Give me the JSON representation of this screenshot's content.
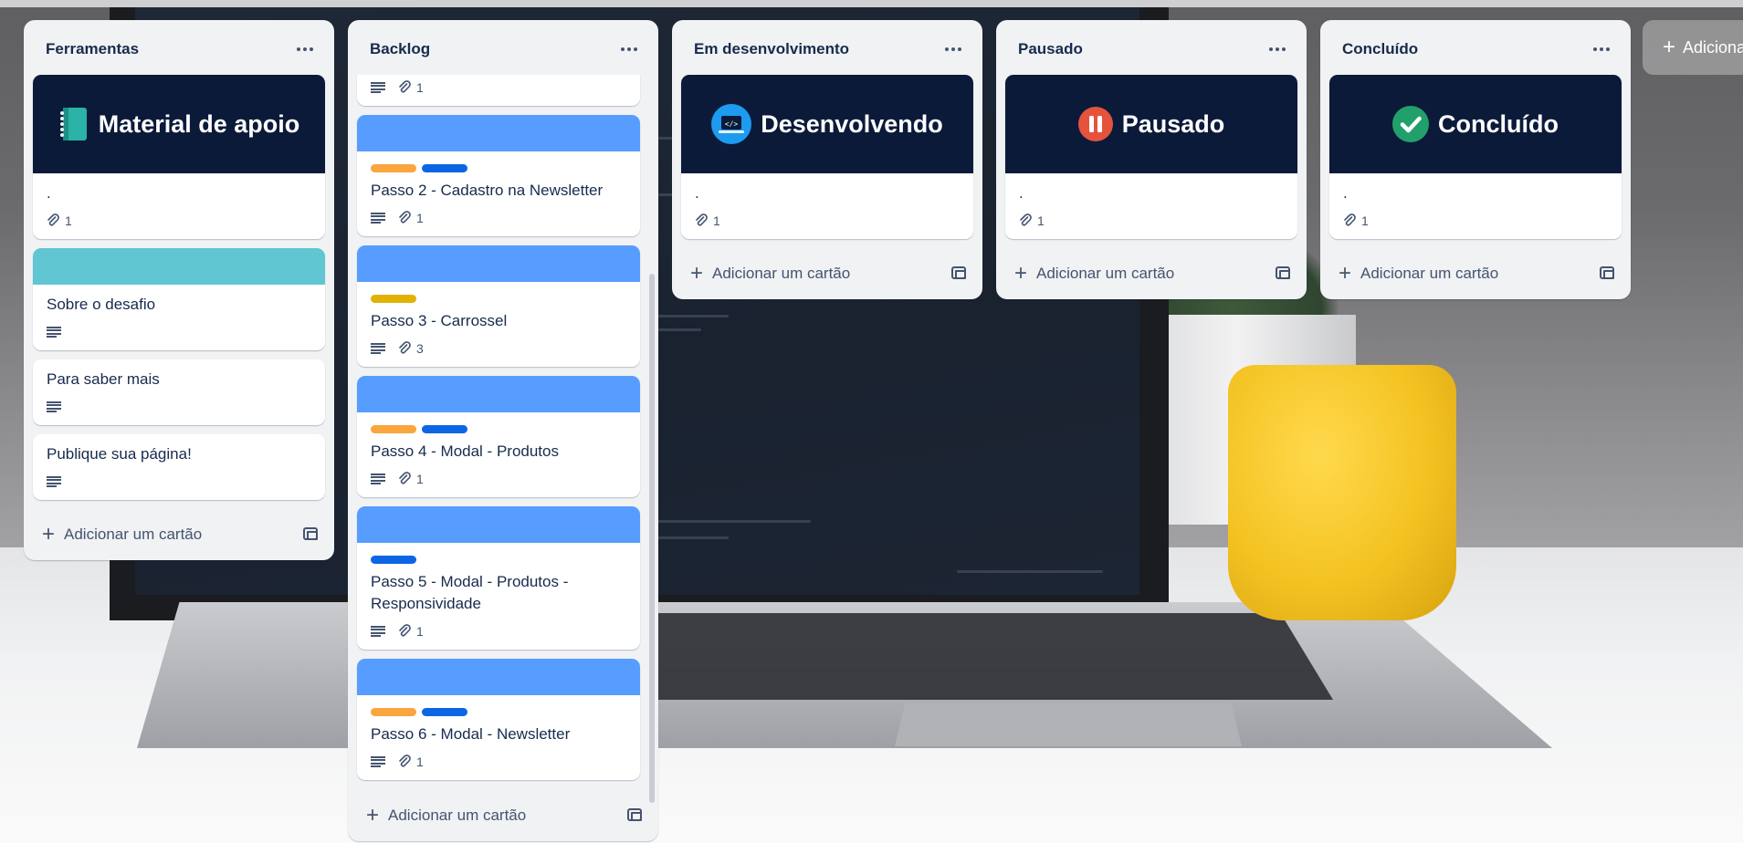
{
  "board": {
    "lists": [
      {
        "title": "Ferramentas",
        "cards": [
          {
            "cover_text": "Material de apoio",
            "title": ".",
            "attachments": "1"
          },
          {
            "title": "Sobre o desafio"
          },
          {
            "title": "Para saber mais"
          },
          {
            "title": "Publique sua página!"
          }
        ]
      },
      {
        "title": "Backlog",
        "cards": [
          {
            "attachments": "1"
          },
          {
            "title": "Passo 2 - Cadastro na Newsletter",
            "attachments": "1"
          },
          {
            "title": "Passo 3 - Carrossel",
            "attachments": "3"
          },
          {
            "title": "Passo 4 - Modal - Produtos",
            "attachments": "1"
          },
          {
            "title": "Passo 5 - Modal - Produtos - Responsividade",
            "attachments": "1"
          },
          {
            "title": "Passo 6 - Modal - Newsletter",
            "attachments": "1"
          }
        ]
      },
      {
        "title": "Em desenvolvimento",
        "cards": [
          {
            "cover_text": "Desenvolvendo",
            "title": ".",
            "attachments": "1"
          }
        ]
      },
      {
        "title": "Pausado",
        "cards": [
          {
            "cover_text": "Pausado",
            "title": ".",
            "attachments": "1"
          }
        ]
      },
      {
        "title": "Concluído",
        "cards": [
          {
            "cover_text": "Concluído",
            "title": ".",
            "attachments": "1"
          }
        ]
      }
    ],
    "add_card_label": "Adicionar um cartão",
    "add_list_label": "Adiciona"
  },
  "colors": {
    "list_bg": "#f1f2f4",
    "cover_dark": "#0c1a3a",
    "cover_blue": "#579dff",
    "cover_teal": "#60c6d2",
    "label_orange": "#faa53d",
    "label_blue": "#0c66e4",
    "label_yellow": "#e2b203"
  },
  "icons": {
    "material_de_apoio": "book-icon",
    "desenvolvendo": "code-laptop-icon",
    "pausado": "pause-icon",
    "concluido": "check-circle-icon"
  }
}
